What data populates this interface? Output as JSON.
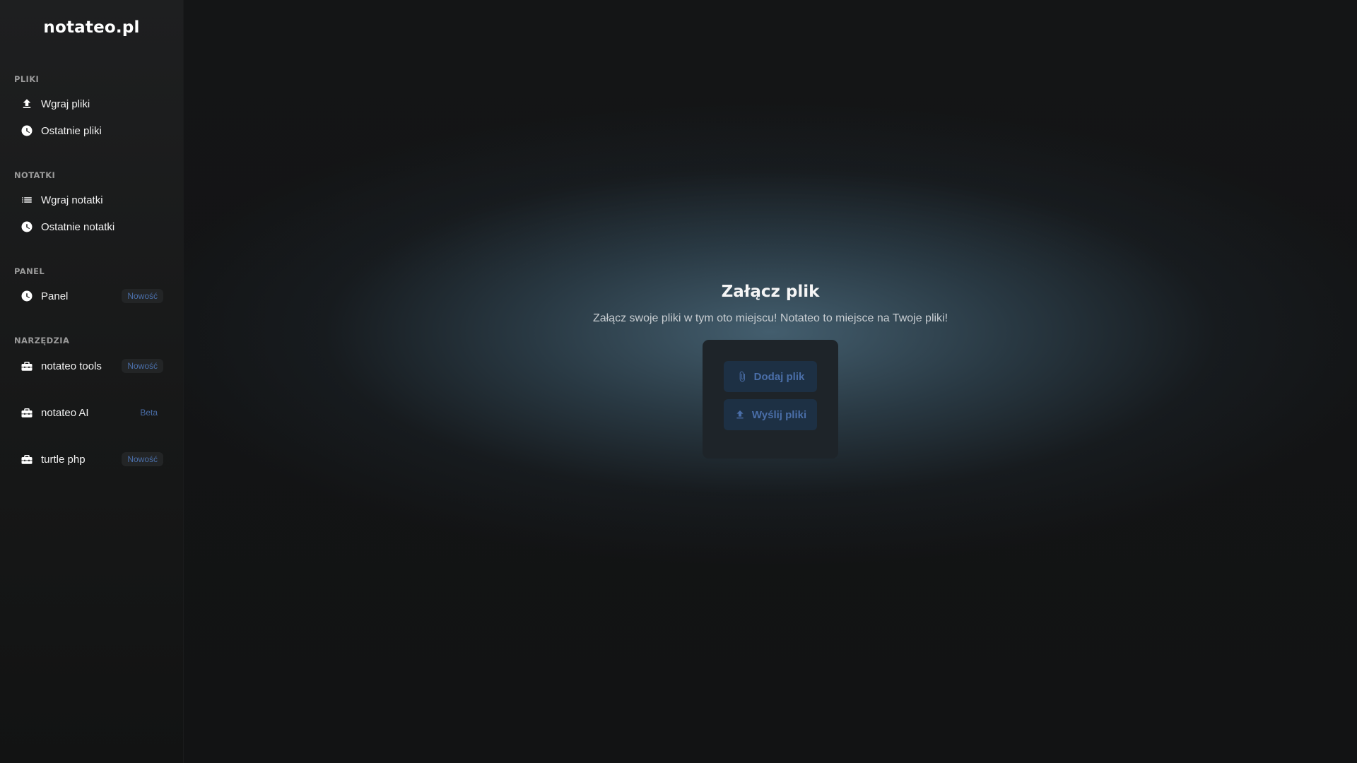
{
  "brand": {
    "name": "notateo.pl"
  },
  "sidebar": {
    "sections": [
      {
        "label": "PLIKI",
        "items": [
          {
            "label": "Wgraj pliki",
            "icon": "upload-icon",
            "badge": ""
          },
          {
            "label": "Ostatnie pliki",
            "icon": "clock-icon",
            "badge": ""
          }
        ]
      },
      {
        "label": "NOTATKI",
        "items": [
          {
            "label": "Wgraj notatki",
            "icon": "list-icon",
            "badge": ""
          },
          {
            "label": "Ostatnie notatki",
            "icon": "clock-icon",
            "badge": ""
          }
        ]
      },
      {
        "label": "PANEL",
        "items": [
          {
            "label": "Panel",
            "icon": "clock-icon",
            "badge": "Nowość"
          }
        ]
      },
      {
        "label": "NARZĘDZIA",
        "items": [
          {
            "label": "notateo tools",
            "icon": "toolbox-icon",
            "badge": "Nowość"
          },
          {
            "label": "notateo AI",
            "icon": "toolbox-icon",
            "badge": "Beta"
          },
          {
            "label": "turtle php",
            "icon": "toolbox-icon",
            "badge": "Nowość"
          }
        ]
      }
    ]
  },
  "main": {
    "title": "Załącz plik",
    "subtitle": "Załącz swoje pliki w tym oto miejscu! Notateo to miejsce na Twoje pliki!",
    "add_button": {
      "label": "Dodaj plik",
      "icon": "paperclip-icon"
    },
    "send_button": {
      "label": "Wyślij pliki",
      "icon": "upload-icon"
    }
  },
  "colors": {
    "accent": "#4a6ea8",
    "button_bg": "#1d3044",
    "card_bg": "#1e2429",
    "sidebar_bg": "#1e1f20"
  }
}
